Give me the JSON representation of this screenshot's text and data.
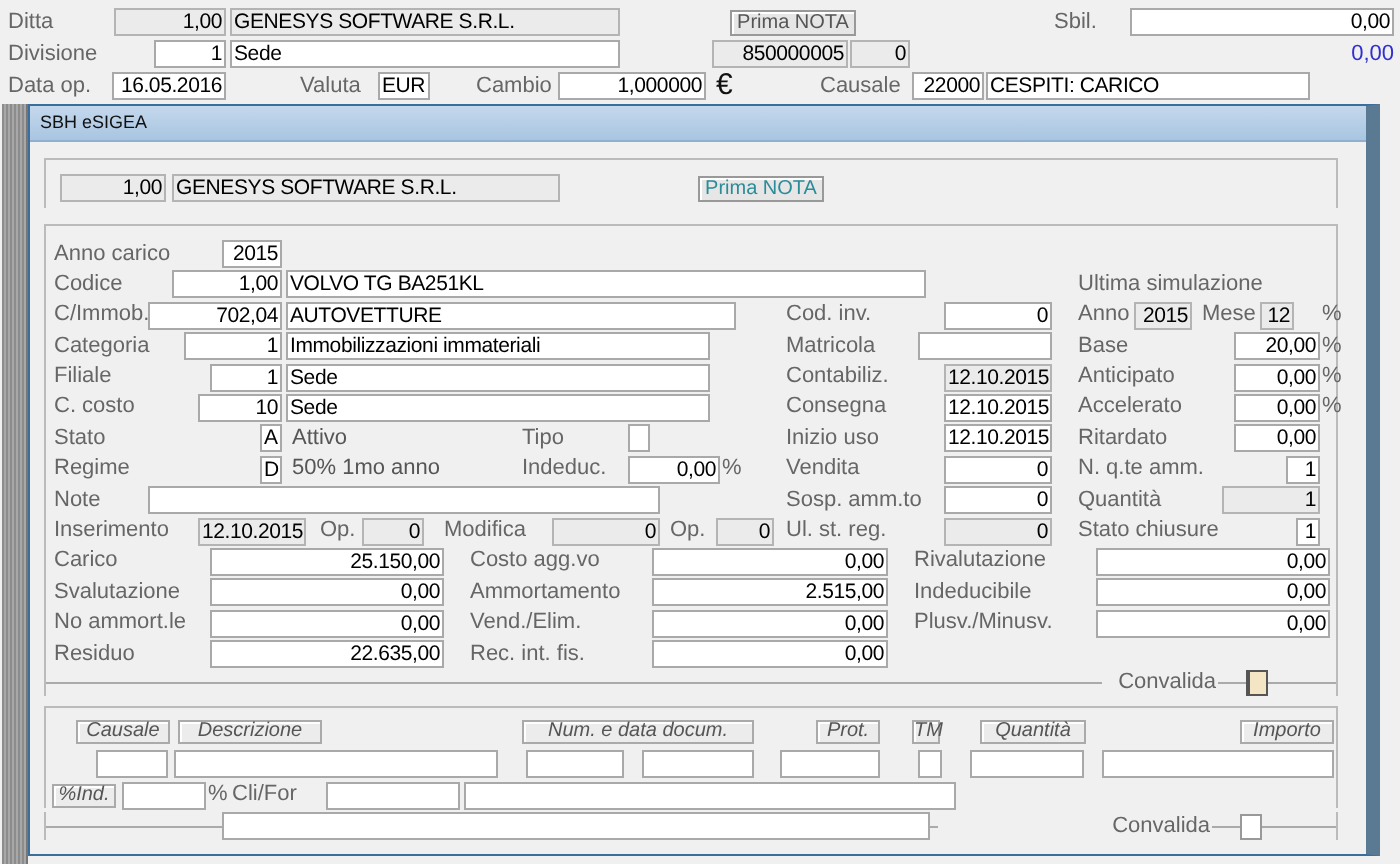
{
  "header": {
    "rows": [
      {
        "items": [
          {
            "kind": "label",
            "text": "Ditta"
          },
          {
            "kind": "field",
            "value": "1,00",
            "readonly": true
          },
          {
            "kind": "field",
            "value": "GENESYS SOFTWARE S.R.L.",
            "readonly": true
          },
          {
            "kind": "button",
            "label": "Prima NOTA"
          },
          {
            "kind": "label",
            "text": "Sbil."
          },
          {
            "kind": "field",
            "value": "0,00",
            "readonly": false
          }
        ]
      },
      {
        "items": [
          {
            "kind": "label",
            "text": "Divisione"
          },
          {
            "kind": "field",
            "value": "1",
            "readonly": false
          },
          {
            "kind": "field",
            "value": "Sede",
            "readonly": false
          },
          {
            "kind": "field",
            "value": "850000005",
            "readonly": true
          },
          {
            "kind": "field",
            "value": "0",
            "readonly": true
          },
          {
            "kind": "total",
            "text": "0,00"
          }
        ]
      },
      {
        "items": [
          {
            "kind": "label",
            "text": "Data op."
          },
          {
            "kind": "field",
            "value": "16.05.2016",
            "readonly": false
          },
          {
            "kind": "label",
            "text": "Valuta"
          },
          {
            "kind": "field",
            "value": "EUR",
            "readonly": false
          },
          {
            "kind": "label",
            "text": "Cambio"
          },
          {
            "kind": "field",
            "value": "1,000000",
            "readonly": false
          },
          {
            "kind": "symbol",
            "text": "€"
          },
          {
            "kind": "label",
            "text": "Causale"
          },
          {
            "kind": "field",
            "value": "22000",
            "readonly": false
          },
          {
            "kind": "field",
            "value": "CESPITI: CARICO",
            "readonly": false
          }
        ]
      }
    ]
  },
  "window": {
    "title": "SBH eSIGEA",
    "company_row": [
      {
        "kind": "field",
        "value": "1,00",
        "readonly": true
      },
      {
        "kind": "field",
        "value": "GENESYS SOFTWARE S.R.L.",
        "readonly": true
      },
      {
        "kind": "button",
        "label": "Prima NOTA"
      }
    ],
    "form_rows": [
      {
        "items": [
          {
            "kind": "label",
            "text": "Anno carico"
          },
          {
            "kind": "field",
            "value": "2015",
            "readonly": false
          }
        ]
      },
      {
        "items": [
          {
            "kind": "label",
            "text": "Codice"
          },
          {
            "kind": "field",
            "value": "1,00",
            "readonly": false
          },
          {
            "kind": "field",
            "value": "VOLVO TG BA251KL",
            "readonly": false
          },
          {
            "kind": "label",
            "text": "Ultima simulazione"
          }
        ]
      },
      {
        "items": [
          {
            "kind": "label",
            "text": "C/Immob."
          },
          {
            "kind": "field",
            "value": "702,04",
            "readonly": false
          },
          {
            "kind": "field",
            "value": "AUTOVETTURE",
            "readonly": false
          },
          {
            "kind": "label",
            "text": "Cod. inv."
          },
          {
            "kind": "field",
            "value": "0",
            "readonly": false
          },
          {
            "kind": "label",
            "text": "Anno"
          },
          {
            "kind": "field",
            "value": "2015",
            "readonly": true
          },
          {
            "kind": "label",
            "text": "Mese"
          },
          {
            "kind": "field",
            "value": "12",
            "readonly": true
          },
          {
            "kind": "label",
            "text": "%"
          }
        ]
      },
      {
        "items": [
          {
            "kind": "label",
            "text": "Categoria"
          },
          {
            "kind": "field",
            "value": "1",
            "readonly": false
          },
          {
            "kind": "field",
            "value": "Immobilizzazioni immateriali",
            "readonly": false
          },
          {
            "kind": "label",
            "text": "Matricola"
          },
          {
            "kind": "field",
            "readonly": false
          },
          {
            "kind": "label",
            "text": "Base"
          },
          {
            "kind": "field",
            "value": "20,00",
            "readonly": false
          },
          {
            "kind": "label",
            "text": "%"
          }
        ]
      },
      {
        "items": [
          {
            "kind": "label",
            "text": "Filiale"
          },
          {
            "kind": "field",
            "value": "1",
            "readonly": false
          },
          {
            "kind": "field",
            "value": "Sede",
            "readonly": false
          },
          {
            "kind": "label",
            "text": "Contabiliz."
          },
          {
            "kind": "field",
            "value": "12.10.2015",
            "readonly": true
          },
          {
            "kind": "label",
            "text": "Anticipato"
          },
          {
            "kind": "field",
            "value": "0,00",
            "readonly": false
          },
          {
            "kind": "label",
            "text": "%"
          }
        ]
      },
      {
        "items": [
          {
            "kind": "label",
            "text": "C. costo"
          },
          {
            "kind": "field",
            "value": "10",
            "readonly": false
          },
          {
            "kind": "field",
            "value": "Sede",
            "readonly": false
          },
          {
            "kind": "label",
            "text": "Consegna"
          },
          {
            "kind": "field",
            "value": "12.10.2015",
            "readonly": false
          },
          {
            "kind": "label",
            "text": "Accelerato"
          },
          {
            "kind": "field",
            "value": "0,00",
            "readonly": false
          },
          {
            "kind": "label",
            "text": "%"
          }
        ]
      },
      {
        "items": [
          {
            "kind": "label",
            "text": "Stato"
          },
          {
            "kind": "field",
            "value": "A",
            "readonly": false
          },
          {
            "kind": "text",
            "text": "Attivo"
          },
          {
            "kind": "label",
            "text": "Tipo"
          },
          {
            "kind": "field",
            "readonly": false
          },
          {
            "kind": "label",
            "text": "Inizio uso"
          },
          {
            "kind": "field",
            "value": "12.10.2015",
            "readonly": false
          },
          {
            "kind": "label",
            "text": "Ritardato"
          },
          {
            "kind": "field",
            "value": "0,00",
            "readonly": false
          }
        ]
      },
      {
        "items": [
          {
            "kind": "label",
            "text": "Regime"
          },
          {
            "kind": "field",
            "value": "D",
            "readonly": false
          },
          {
            "kind": "text",
            "text": "50% 1mo anno"
          },
          {
            "kind": "label",
            "text": "Indeduc."
          },
          {
            "kind": "field",
            "value": "0,00",
            "readonly": false
          },
          {
            "kind": "label",
            "text": "%"
          },
          {
            "kind": "label",
            "text": "Vendita"
          },
          {
            "kind": "field",
            "value": "0",
            "readonly": false
          },
          {
            "kind": "label",
            "text": "N. q.te amm."
          },
          {
            "kind": "field",
            "value": "1",
            "readonly": false
          }
        ]
      },
      {
        "items": [
          {
            "kind": "label",
            "text": "Note"
          },
          {
            "kind": "field",
            "readonly": false
          },
          {
            "kind": "label",
            "text": "Sosp. amm.to"
          },
          {
            "kind": "field",
            "value": "0",
            "readonly": false
          },
          {
            "kind": "label",
            "text": "Quantità"
          },
          {
            "kind": "field",
            "value": "1",
            "readonly": true
          }
        ]
      },
      {
        "items": [
          {
            "kind": "label",
            "text": "Inserimento"
          },
          {
            "kind": "field",
            "value": "12.10.2015",
            "readonly": true
          },
          {
            "kind": "label",
            "text": "Op."
          },
          {
            "kind": "field",
            "value": "0",
            "readonly": true
          },
          {
            "kind": "label",
            "text": "Modifica"
          },
          {
            "kind": "field",
            "value": "0",
            "readonly": true
          },
          {
            "kind": "label",
            "text": "Op."
          },
          {
            "kind": "field",
            "value": "0",
            "readonly": true
          },
          {
            "kind": "label",
            "text": "Ul. st. reg."
          },
          {
            "kind": "field",
            "value": "0",
            "readonly": true
          },
          {
            "kind": "label",
            "text": "Stato chiusure"
          },
          {
            "kind": "field",
            "value": "1",
            "readonly": false
          }
        ]
      },
      {
        "items": [
          {
            "kind": "label",
            "text": "Carico"
          },
          {
            "kind": "field",
            "value": "25.150,00",
            "readonly": false
          },
          {
            "kind": "label",
            "text": "Costo agg.vo"
          },
          {
            "kind": "field",
            "value": "0,00",
            "readonly": false
          },
          {
            "kind": "label",
            "text": "Rivalutazione"
          },
          {
            "kind": "field",
            "value": "0,00",
            "readonly": false
          }
        ]
      },
      {
        "items": [
          {
            "kind": "label",
            "text": "Svalutazione"
          },
          {
            "kind": "field",
            "value": "0,00",
            "readonly": false
          },
          {
            "kind": "label",
            "text": "Ammortamento"
          },
          {
            "kind": "field",
            "value": "2.515,00",
            "readonly": false
          },
          {
            "kind": "label",
            "text": "Indeducibile"
          },
          {
            "kind": "field",
            "value": "0,00",
            "readonly": false
          }
        ]
      },
      {
        "items": [
          {
            "kind": "label",
            "text": "No ammort.le"
          },
          {
            "kind": "field",
            "value": "0,00",
            "readonly": false
          },
          {
            "kind": "label",
            "text": "Vend./Elim."
          },
          {
            "kind": "field",
            "value": "0,00",
            "readonly": false
          },
          {
            "kind": "label",
            "text": "Plusv./Minusv."
          },
          {
            "kind": "field",
            "value": "0,00",
            "readonly": false
          }
        ]
      },
      {
        "items": [
          {
            "kind": "label",
            "text": "Residuo"
          },
          {
            "kind": "field",
            "value": "22.635,00",
            "readonly": false
          },
          {
            "kind": "label",
            "text": "Rec. int. fis."
          },
          {
            "kind": "field",
            "value": "0,00",
            "readonly": false
          }
        ]
      }
    ],
    "convalida": {
      "label": "Convalida",
      "checked": false,
      "focused": true
    },
    "movement": {
      "rows": [
        {
          "items": [
            {
              "kind": "tag",
              "text": "Causale"
            },
            {
              "kind": "tag",
              "text": "Descrizione"
            },
            {
              "kind": "tag",
              "text": "Num. e data docum."
            },
            {
              "kind": "tag",
              "text": "Prot."
            },
            {
              "kind": "tag",
              "text": "TM"
            },
            {
              "kind": "tag",
              "text": "Quantità"
            },
            {
              "kind": "tag",
              "text": "Importo"
            }
          ]
        },
        {
          "items": [
            {
              "kind": "field",
              "readonly": false
            },
            {
              "kind": "field",
              "readonly": false
            },
            {
              "kind": "field",
              "readonly": false
            },
            {
              "kind": "field",
              "readonly": false
            },
            {
              "kind": "field",
              "readonly": false
            },
            {
              "kind": "field",
              "readonly": false
            },
            {
              "kind": "field",
              "readonly": false
            },
            {
              "kind": "field",
              "readonly": false
            }
          ]
        },
        {
          "items": [
            {
              "kind": "tag",
              "text": "%Ind."
            },
            {
              "kind": "field",
              "readonly": false
            },
            {
              "kind": "label",
              "text": "%"
            },
            {
              "kind": "label",
              "text": "Cli/For"
            },
            {
              "kind": "field",
              "readonly": false
            },
            {
              "kind": "field",
              "readonly": false
            }
          ]
        }
      ],
      "footer": {
        "field": {
          "readonly": false
        },
        "convalida": {
          "label": "Convalida",
          "checked": false,
          "focused": false
        }
      }
    }
  }
}
